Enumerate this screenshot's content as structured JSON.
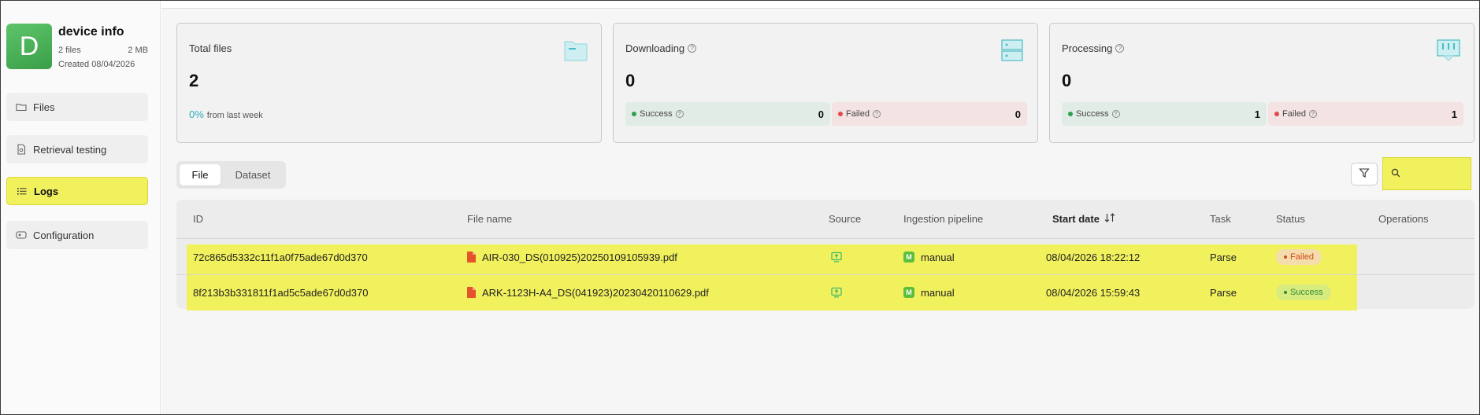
{
  "dataset": {
    "avatar_letter": "D",
    "title": "device info",
    "file_count": "2 files",
    "size": "2 MB",
    "created": "Created 08/04/2026"
  },
  "nav": {
    "items": [
      {
        "label": "Files",
        "icon": "folder-icon"
      },
      {
        "label": "Retrieval testing",
        "icon": "document-search-icon"
      },
      {
        "label": "Logs",
        "icon": "list-icon",
        "active": true
      },
      {
        "label": "Configuration",
        "icon": "config-icon"
      }
    ]
  },
  "cards": {
    "total": {
      "title": "Total files",
      "value": "2",
      "trend_pct": "0%",
      "trend_text": "from last week",
      "icon": "folder-icon"
    },
    "downloading": {
      "title": "Downloading",
      "value": "0",
      "success_label": "Success",
      "success_value": "0",
      "failed_label": "Failed",
      "failed_value": "0",
      "icon": "server-icon"
    },
    "processing": {
      "title": "Processing",
      "value": "0",
      "success_label": "Success",
      "success_value": "1",
      "failed_label": "Failed",
      "failed_value": "1",
      "icon": "processing-icon"
    }
  },
  "tabs": {
    "file": "File",
    "dataset": "Dataset"
  },
  "search": {
    "placeholder": ""
  },
  "table": {
    "headers": {
      "id": "ID",
      "file_name": "File name",
      "source": "Source",
      "pipeline": "Ingestion pipeline",
      "start_date": "Start date",
      "task": "Task",
      "status": "Status",
      "operations": "Operations"
    },
    "rows": [
      {
        "id": "72c865d5332c11f1a0f75ade67d0d370",
        "file_name": "AIR-030_DS(010925)20250109105939.pdf",
        "pipeline": "manual",
        "pipeline_badge": "M",
        "start_date": "08/04/2026 18:22:12",
        "task": "Parse",
        "status": "Failed"
      },
      {
        "id": "8f213b3b331811f1ad5c5ade67d0d370",
        "file_name": "ARK-1123H-A4_DS(041923)20230420110629.pdf",
        "pipeline": "manual",
        "pipeline_badge": "M",
        "start_date": "08/04/2026 15:59:43",
        "task": "Parse",
        "status": "Success"
      }
    ]
  },
  "colors": {
    "highlight": "#f1f15e",
    "accent_teal": "#2bb0bd",
    "success_green": "#2fa04f",
    "failed_red": "#e04a4a"
  }
}
